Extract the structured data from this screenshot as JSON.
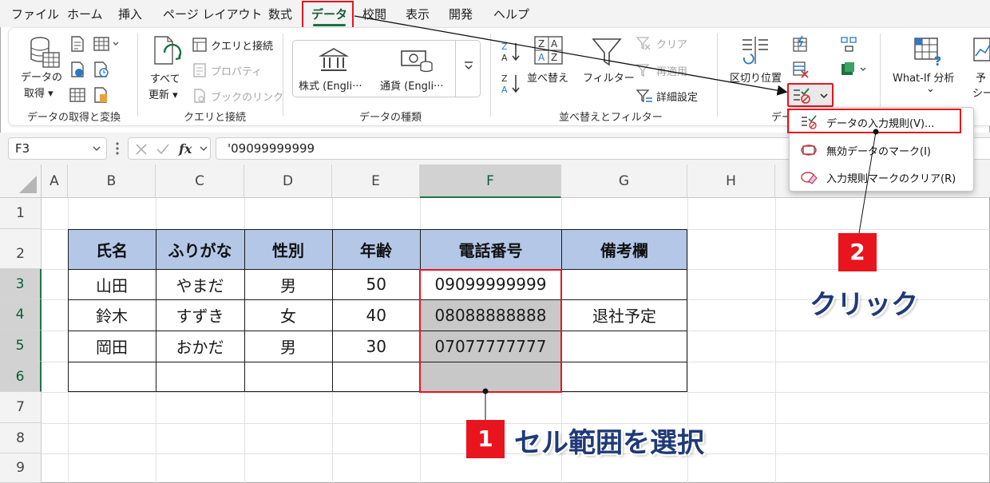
{
  "menu": {
    "items": [
      "ファイル",
      "ホーム",
      "挿入",
      "ページ レイアウト",
      "数式",
      "データ",
      "校閲",
      "表示",
      "開発",
      "ヘルプ"
    ],
    "active": "データ"
  },
  "ribbon": {
    "get_data_line1": "データの",
    "get_data_line2": "取得 ▾",
    "group_get_transform": "データの取得と変換",
    "refresh_line1": "すべて",
    "refresh_line2": "更新 ▾",
    "queries_connections": "クエリと接続",
    "properties": "プロパティ",
    "workbook_links": "ブックのリンク",
    "group_queries": "クエリと接続",
    "stocks": "株式 (Engli···",
    "currencies": "通貨 (Engli···",
    "group_data_types": "データの種類",
    "sort": "並べ替え",
    "filter": "フィルター",
    "clear": "クリア",
    "reapply": "再適用",
    "advanced": "詳細設定",
    "group_sort_filter": "並べ替えとフィルター",
    "text_to_columns": "区切り位置",
    "group_data_tools": "デー",
    "what_if": "What-If 分析",
    "what_if_arrow": "⌄",
    "forecast_sheet_line1": "予",
    "forecast_sheet_line2": "シー"
  },
  "dropdown": {
    "items": [
      "データの入力規則(V)...",
      "無効データのマーク(I)",
      "入力規則マークのクリア(R)"
    ]
  },
  "formula_bar": {
    "name_box": "F3",
    "formula": "'09099999999"
  },
  "columns": [
    "A",
    "B",
    "C",
    "D",
    "E",
    "F",
    "G",
    "H"
  ],
  "rows": [
    "1",
    "2",
    "3",
    "4",
    "5",
    "6",
    "7",
    "8",
    "9"
  ],
  "table": {
    "headers": [
      "氏名",
      "ふりがな",
      "性別",
      "年齢",
      "電話番号",
      "備考欄"
    ],
    "rows": [
      [
        "山田",
        "やまだ",
        "男",
        "50",
        "09099999999",
        ""
      ],
      [
        "鈴木",
        "すずき",
        "女",
        "40",
        "08088888888",
        "退社予定"
      ],
      [
        "岡田",
        "おかだ",
        "男",
        "30",
        "07077777777",
        ""
      ],
      [
        "",
        "",
        "",
        "",
        "",
        ""
      ]
    ]
  },
  "annotations": {
    "step1_number": "1",
    "step1_text": "セル範囲を選択",
    "step2_number": "2",
    "step2_text": "クリック"
  },
  "colors": {
    "accent_green": "#217346",
    "header_fill": "#b4c7e7",
    "highlight_red": "#e8141e",
    "selection_gray": "#c8c8c8",
    "callout_blue": "#1f3a78"
  }
}
